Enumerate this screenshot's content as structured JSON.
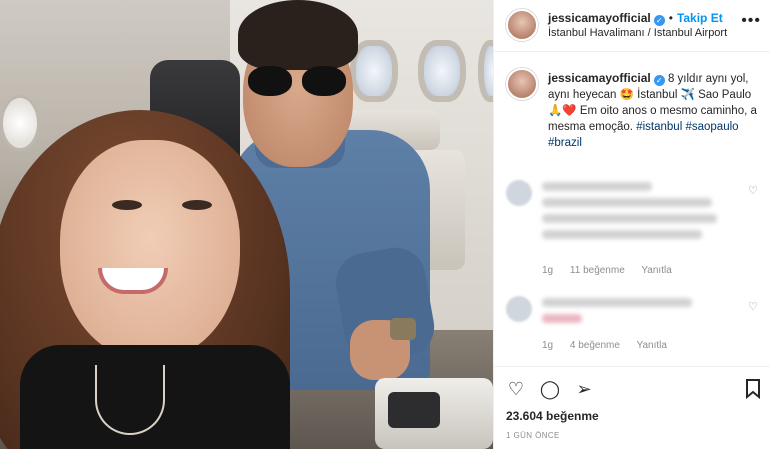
{
  "post": {
    "username": "jessicamayofficial",
    "follow_label": "Takip Et",
    "location": "İstanbul Havalimanı / Istanbul Airport",
    "caption": {
      "text_before": "8 yıldır aynı yol, aynı heyecan 🤩 İstanbul ✈️ Sao Paulo 🙏❤️ Em oito anos o mesmo caminho, a mesma emoção.",
      "hashtags": [
        "#istanbul",
        "#saopaulo",
        "#brazil"
      ]
    },
    "comments": [
      {
        "time": "1g",
        "likes": "11 beğenme",
        "reply": "Yanıtla"
      },
      {
        "time": "1g",
        "likes": "4 beğenme",
        "reply": "Yanıtla"
      }
    ],
    "likes_count": "23.604 beğenme",
    "posted_ago": "1 GÜN ÖNCE"
  },
  "icons": {
    "verified": "verified-check-icon",
    "more": "more-dots-icon",
    "like": "heart-icon",
    "comment": "comment-bubble-icon",
    "share": "paper-plane-icon",
    "save": "bookmark-icon"
  },
  "colors": {
    "link": "#0095f6",
    "hashtag": "#00376b",
    "verified": "#3897f0"
  }
}
